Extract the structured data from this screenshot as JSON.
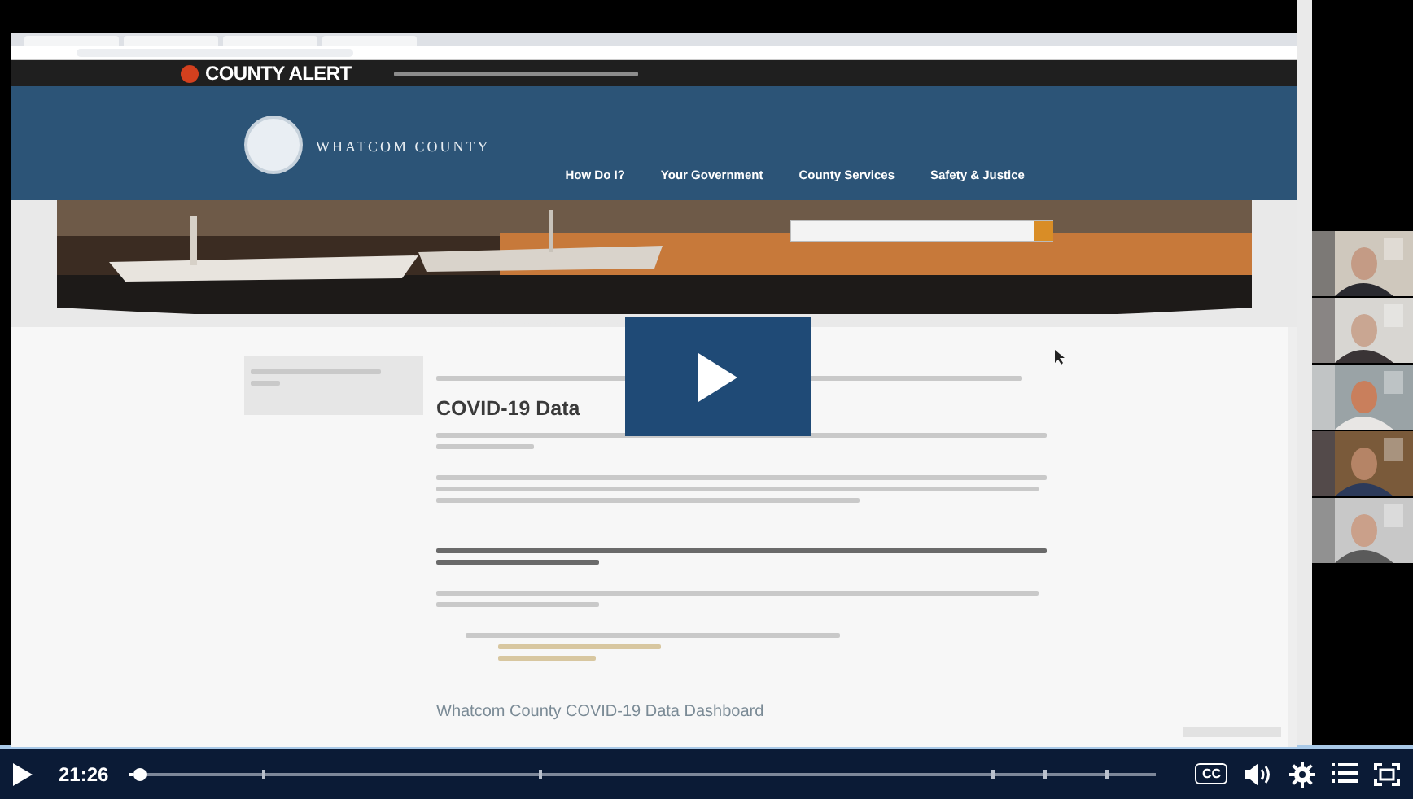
{
  "site": {
    "alert_title": "COUNTY ALERT",
    "logo_text": "WHATCOM COUNTY",
    "nav": [
      "How Do I?",
      "Your Government",
      "County Services",
      "Safety & Justice"
    ],
    "heading": "COVID-19 Data",
    "subheading": "Whatcom County COVID-19 Data Dashboard"
  },
  "player": {
    "playing": false,
    "time": "21:26",
    "level": 0.005,
    "captions_label": "CC"
  }
}
